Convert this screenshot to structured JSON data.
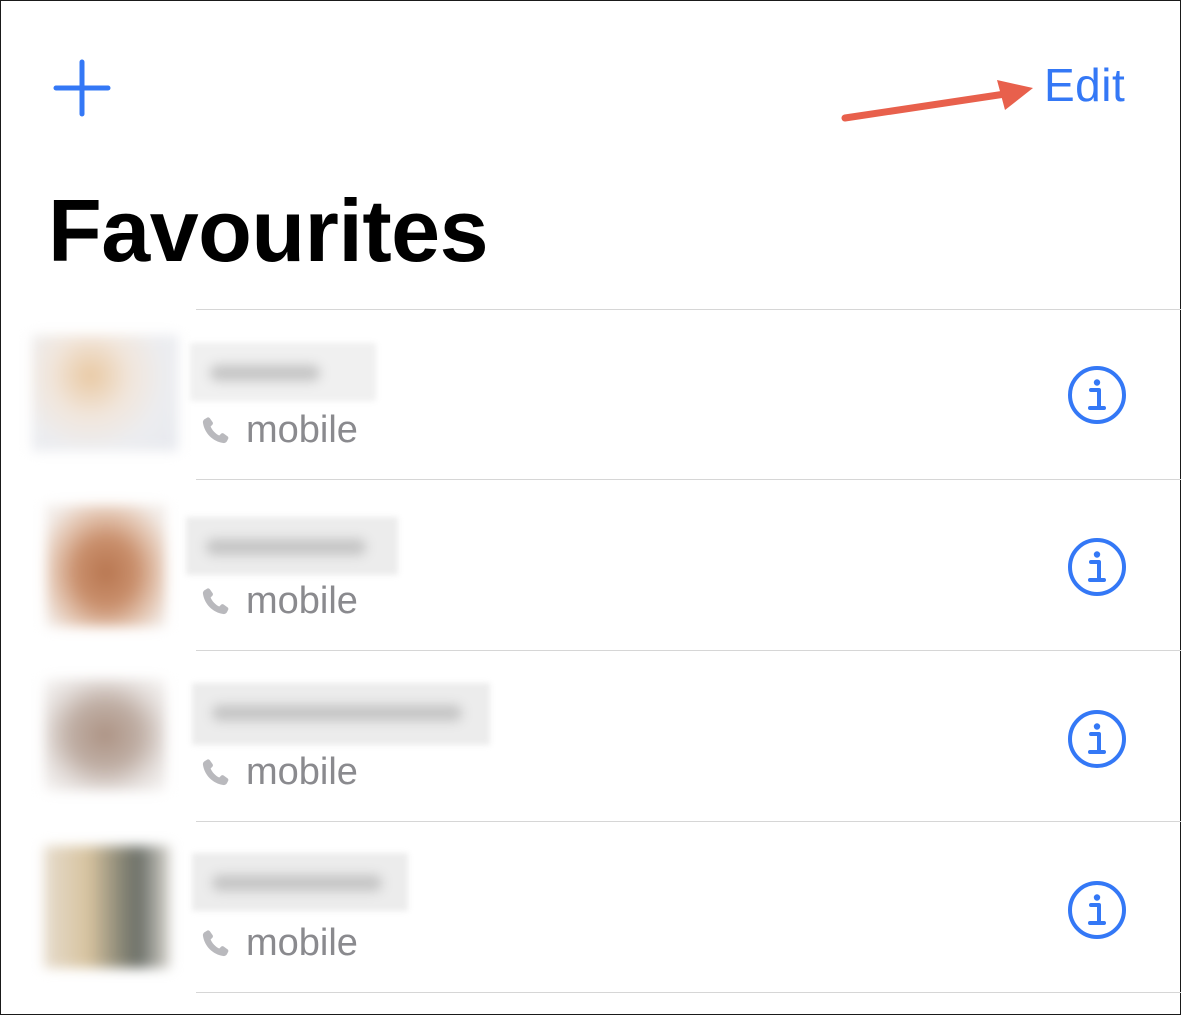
{
  "toolbar": {
    "add_icon": "plus-icon",
    "edit_label": "Edit"
  },
  "page_title": "Favourites",
  "accent_color": "#3478f6",
  "annotation_color": "#e8604c",
  "contacts": [
    {
      "number_type": "mobile",
      "info_icon": "info-circle-icon"
    },
    {
      "number_type": "mobile",
      "info_icon": "info-circle-icon"
    },
    {
      "number_type": "mobile",
      "info_icon": "info-circle-icon"
    },
    {
      "number_type": "mobile",
      "info_icon": "info-circle-icon"
    }
  ]
}
